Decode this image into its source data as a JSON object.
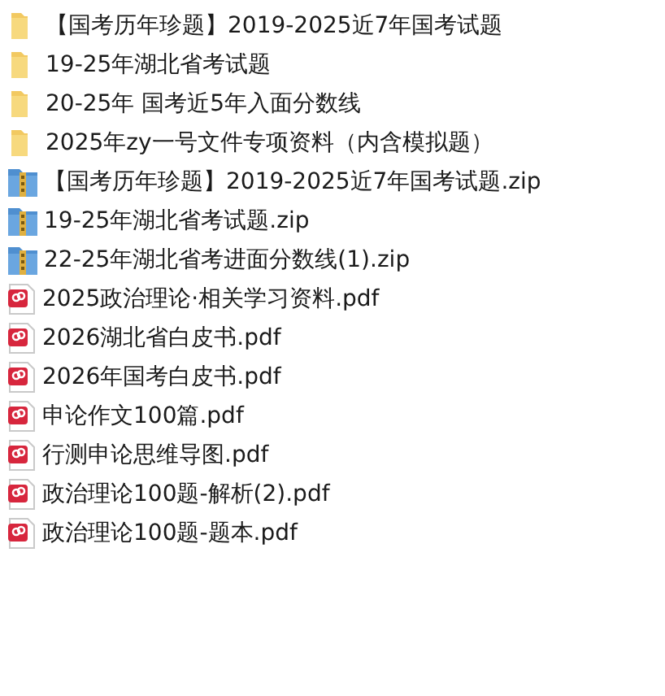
{
  "files": [
    {
      "kind": "folder",
      "name": "【国考历年珍题】2019-2025近7年国考试题"
    },
    {
      "kind": "folder",
      "name": "19-25年湖北省考试题"
    },
    {
      "kind": "folder",
      "name": "20-25年 国考近5年入面分数线"
    },
    {
      "kind": "folder",
      "name": "2025年zy一号文件专项资料（内含模拟题）"
    },
    {
      "kind": "zip",
      "name": "【国考历年珍题】2019-2025近7年国考试题.zip"
    },
    {
      "kind": "zip",
      "name": "19-25年湖北省考试题.zip"
    },
    {
      "kind": "zip",
      "name": "22-25年湖北省考进面分数线(1).zip"
    },
    {
      "kind": "pdf",
      "name": "2025政治理论·相关学习资料.pdf"
    },
    {
      "kind": "pdf",
      "name": "2026湖北省白皮书.pdf"
    },
    {
      "kind": "pdf",
      "name": "2026年国考白皮书.pdf"
    },
    {
      "kind": "pdf",
      "name": "申论作文100篇.pdf"
    },
    {
      "kind": "pdf",
      "name": "行测申论思维导图.pdf"
    },
    {
      "kind": "pdf",
      "name": "政治理论100题-解析(2).pdf"
    },
    {
      "kind": "pdf",
      "name": "政治理论100题-题本.pdf"
    }
  ]
}
